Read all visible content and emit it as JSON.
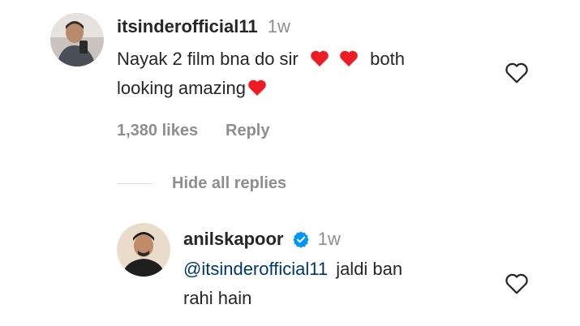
{
  "comment": {
    "username": "itsinderofficial11",
    "time": "1w",
    "text_line1_a": "Nayak 2 film bna do sir",
    "text_line1_b": "both",
    "text_line2": "looking amazing",
    "likes": "1,380 likes",
    "reply_label": "Reply",
    "avatar_icon": "user-avatar-photo"
  },
  "replies_toggle": {
    "label": "Hide all replies"
  },
  "reply": {
    "username": "anilskapoor",
    "time": "1w",
    "verified_icon": "verified-badge-icon",
    "mention": "@itsinderofficial11",
    "text_line1": "jaldi ban",
    "text_line2": "rahi hain",
    "avatar_icon": "user-avatar-photo"
  },
  "colors": {
    "heart_red": "#ed1c24",
    "verified_blue": "#0095f6",
    "meta_gray": "#8e8e8e",
    "mention_blue": "#00376b"
  }
}
